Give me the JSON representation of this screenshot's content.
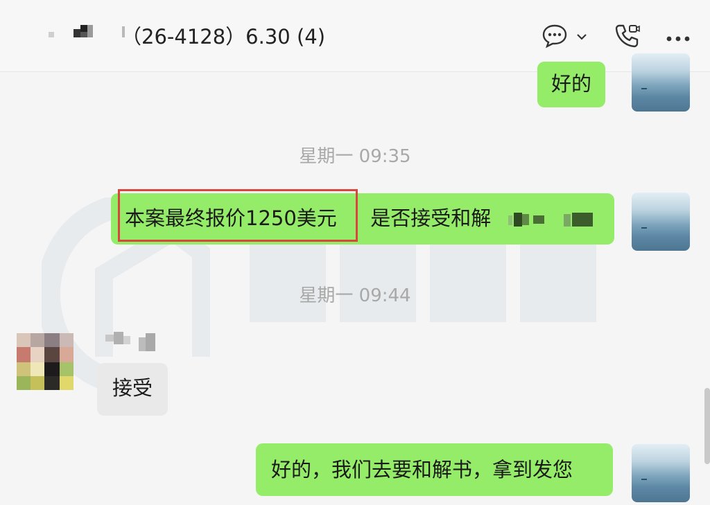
{
  "header": {
    "title": "（26-4128）6.30 (4)",
    "icons": [
      "chat-bubble-icon",
      "chevron-down-icon",
      "video-call-icon",
      "more-icon"
    ]
  },
  "colors": {
    "accent_bubble": "#95ec69",
    "incoming_bubble": "#e9e9e9",
    "highlight_border": "#d9463d",
    "timestamp": "#a8a8a8"
  },
  "messages": {
    "m1": {
      "text": "好的",
      "direction": "outgoing"
    },
    "t1": "星期一 09:35",
    "m2": {
      "highlighted": "本案最终报价1250美元",
      "rest": "是否接受和解",
      "direction": "outgoing"
    },
    "t2": "星期一 09:44",
    "m3": {
      "text": "接受",
      "direction": "incoming"
    },
    "m4": {
      "text": "好的，我们去要和解书，拿到发您",
      "direction": "outgoing"
    }
  }
}
